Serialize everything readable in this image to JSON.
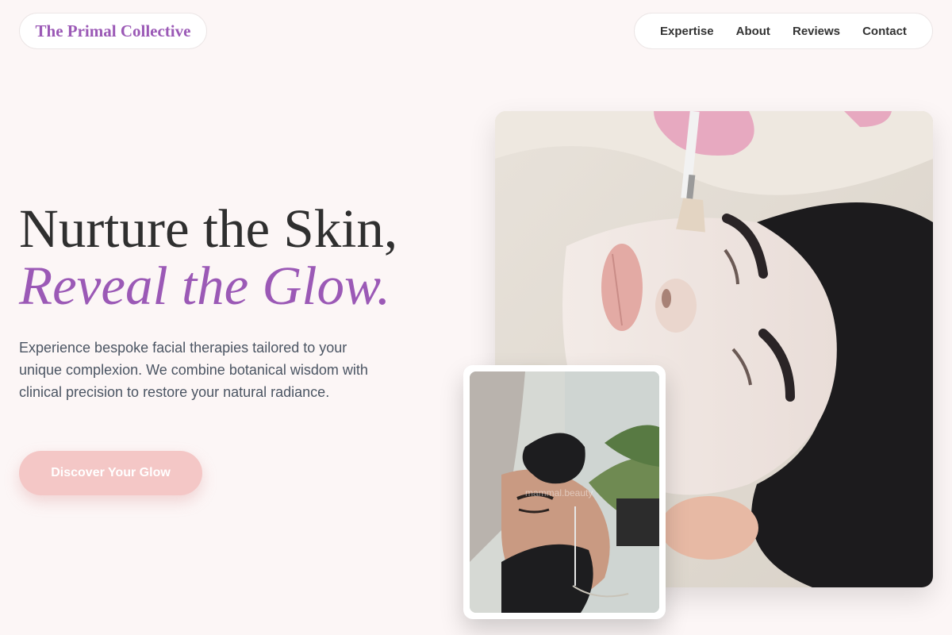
{
  "header": {
    "brand": "The Primal Collective",
    "nav": [
      {
        "label": "Expertise"
      },
      {
        "label": "About"
      },
      {
        "label": "Reviews"
      },
      {
        "label": "Contact"
      }
    ]
  },
  "hero": {
    "headline_line1": "Nurture the Skin,",
    "headline_line2": "Reveal the Glow.",
    "description": "Experience bespoke facial therapies tailored to your unique complexion. We combine botanical wisdom with clinical precision to restore your natural radiance.",
    "cta_label": "Discover Your Glow"
  },
  "images": {
    "inset_watermark": "mammal.beauty"
  },
  "colors": {
    "accent": "#9b59b6",
    "cta_background": "#f4c7c6",
    "page_background": "#fcf6f6"
  }
}
